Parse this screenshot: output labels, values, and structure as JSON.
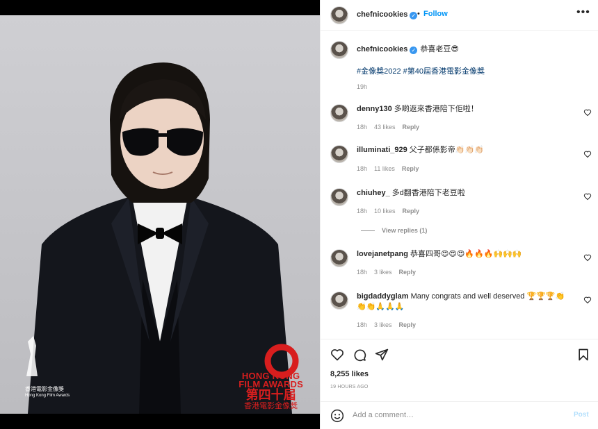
{
  "post": {
    "username": "chefnicookies",
    "follow_label": "Follow",
    "dot": "•",
    "more_label": "•••",
    "verified_glyph": "✓"
  },
  "photo": {
    "award_number": "40",
    "award_en_line1": "HONG KONG",
    "award_en_line2": "FILM AWARDS",
    "award_zh": "第四十屆",
    "award_zh2": "香港電影金像獎",
    "hkfa_zh": "香港電影金像獎",
    "hkfa_en": "Hong Kong Film Awards"
  },
  "caption": {
    "username": "chefnicookies",
    "text": "恭喜老豆😎",
    "hashtags": "#金像獎2022 #第40屆香港電影金像獎",
    "time": "19h"
  },
  "comments": [
    {
      "username": "denny130",
      "text": "多啲返來香港陪下佢啦！",
      "time": "18h",
      "likes": "43 likes",
      "reply": "Reply"
    },
    {
      "username": "illuminati_929",
      "text": "父子都係影帝👏🏻👏🏻👏🏻",
      "time": "18h",
      "likes": "11 likes",
      "reply": "Reply"
    },
    {
      "username": "chiuhey_",
      "text": "多d翻香港陪下老豆啦",
      "time": "18h",
      "likes": "10 likes",
      "reply": "Reply",
      "view_replies": "View replies (1)"
    },
    {
      "username": "lovejanetpang",
      "text": "恭喜四哥😍😍😍🔥🔥🔥🙌🙌🙌",
      "time": "18h",
      "likes": "3 likes",
      "reply": "Reply"
    },
    {
      "username": "bigdaddyglam",
      "text": "Many congrats and well deserved 🏆🏆🏆👏 👏👏🙏🙏🙏",
      "time": "18h",
      "likes": "3 likes",
      "reply": "Reply"
    }
  ],
  "stats": {
    "likes": "8,255 likes",
    "ago": "19 HOURS AGO"
  },
  "composer": {
    "placeholder": "Add a comment…",
    "post_label": "Post"
  },
  "colors": {
    "accent": "#0095f6",
    "link": "#00376b",
    "muted": "#8e8e8e",
    "award_red": "#d81e1e"
  },
  "icons": [
    "heart-icon",
    "comment-icon",
    "share-icon",
    "bookmark-icon",
    "emoji-icon",
    "verified-icon",
    "more-icon"
  ]
}
